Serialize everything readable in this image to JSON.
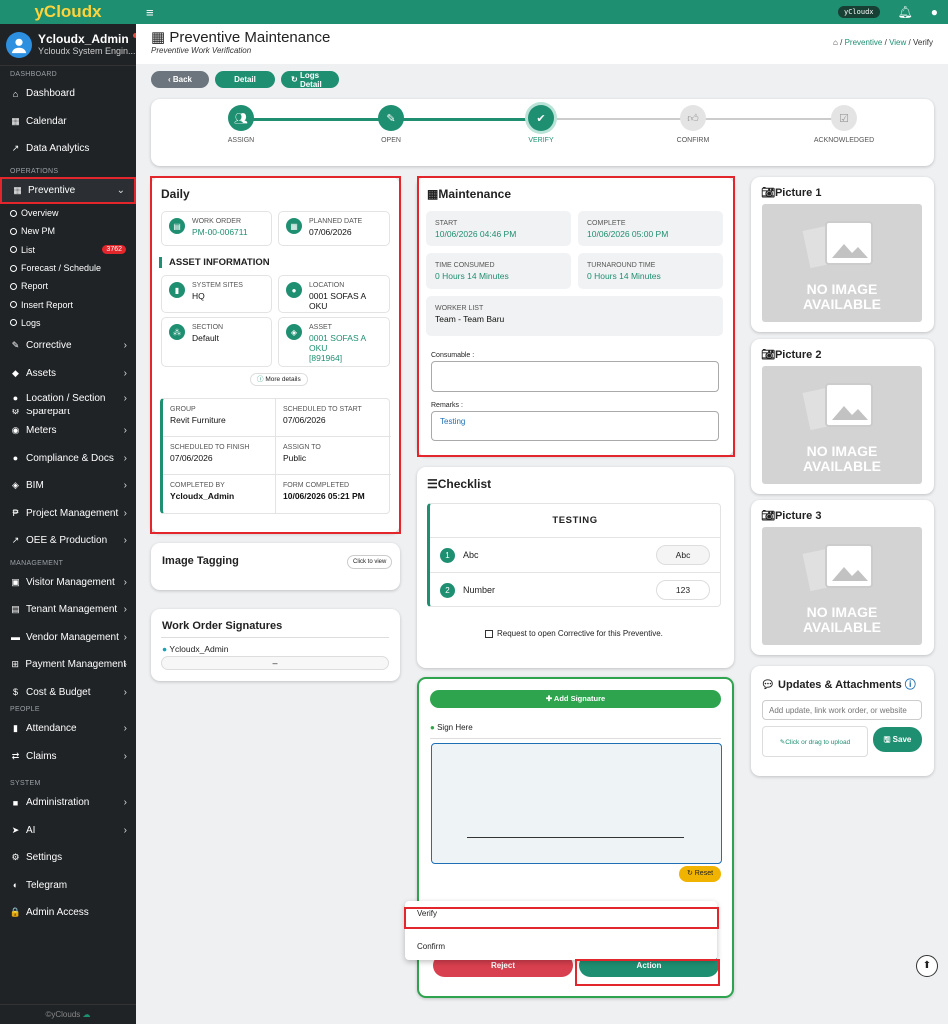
{
  "brand": "yCloudx",
  "user": {
    "name": "Ycloudx_Admin",
    "role": "Ycloudx System Engin..."
  },
  "sidebar": {
    "sec_dashboard": "DASHBOARD",
    "dashboard": "Dashboard",
    "calendar": "Calendar",
    "analytics": "Data Analytics",
    "sec_operations": "OPERATIONS",
    "preventive": "Preventive",
    "subs": [
      "Overview",
      "New PM",
      "List",
      "Forecast / Schedule",
      "Report",
      "Insert Report",
      "Logs"
    ],
    "list_badge": "3762",
    "corrective": "Corrective",
    "assets": "Assets",
    "location": "Location / Section",
    "sparepart": "Sparepart",
    "meters": "Meters",
    "compliance": "Compliance & Docs",
    "bim": "BIM",
    "project": "Project Management",
    "oee": "OEE & Production",
    "sec_management": "MANAGEMENT",
    "visitor": "Visitor Management",
    "tenant": "Tenant Management",
    "vendor": "Vendor Management",
    "payment": "Payment Management",
    "cost": "Cost & Budget",
    "sec_people": "PEOPLE",
    "attendance": "Attendance",
    "claims": "Claims",
    "sec_system": "SYSTEM",
    "administration": "Administration",
    "ai": "AI",
    "settings": "Settings",
    "telegram": "Telegram",
    "admin_access": "Admin Access",
    "copyright": "©yClouds"
  },
  "topbar": {
    "pill": "yCloudx"
  },
  "header": {
    "title": "Preventive Maintenance",
    "subtitle": "Preventive Work Verification",
    "bc1": "Preventive",
    "bc_sep": "/",
    "bc2": "View",
    "bc3": "Verify"
  },
  "buttons": {
    "back": "Back",
    "detail": "Detail",
    "logs": "Logs Detail"
  },
  "steps": [
    "ASSIGN",
    "OPEN",
    "VERIFY",
    "CONFIRM",
    "ACKNOWLEDGED"
  ],
  "daily": {
    "title": "Daily",
    "work_order_k": "WORK ORDER",
    "work_order_v": "PM-00-006711",
    "planned_k": "PLANNED DATE",
    "planned_v": "07/06/2026",
    "asset_info": "ASSET INFORMATION",
    "sites_k": "SYSTEM SITES",
    "sites_v": "HQ",
    "location_k": "LOCATION",
    "location_v": "0001 SOFAS A OKU",
    "section_k": "SECTION",
    "section_v": "Default",
    "asset_k": "ASSET",
    "asset_v1": "0001 SOFAS A OKU",
    "asset_v2": "[891964]",
    "more": "More details",
    "group_k": "GROUP",
    "group_v": "Revit Furniture",
    "sched_start_k": "SCHEDULED TO START",
    "sched_start_v": "07/06/2026",
    "sched_finish_k": "SCHEDULED TO FINISH",
    "sched_finish_v": "07/06/2026",
    "assign_k": "ASSIGN TO",
    "assign_v": "Public",
    "completed_k": "COMPLETED BY",
    "completed_v": "Ycloudx_Admin",
    "form_k": "FORM COMPLETED",
    "form_v": "10/06/2026 05:21 PM"
  },
  "tagging": {
    "title": "Image Tagging",
    "btn": "Click to view"
  },
  "signatures": {
    "title": "Work Order Signatures",
    "name": "Ycloudx_Admin",
    "value": "–"
  },
  "maintenance": {
    "title": "Maintenance",
    "start_k": "START",
    "start_v": "10/06/2026 04:46 PM",
    "complete_k": "COMPLETE",
    "complete_v": "10/06/2026 05:00 PM",
    "time_k": "TIME CONSUMED",
    "time_v": "0 Hours 14 Minutes",
    "turn_k": "TURNAROUND TIME",
    "turn_v": "0 Hours 14 Minutes",
    "worker_k": "WORKER LIST",
    "worker_v": "Team - Team Baru",
    "consumable_label": "Consumable :",
    "consumable_value": "",
    "remarks_label": "Remarks :",
    "remarks_value": "Testing"
  },
  "checklist": {
    "title": "Checklist",
    "header": "TESTING",
    "items": [
      {
        "num": "1",
        "label": "Abc",
        "value": "Abc"
      },
      {
        "num": "2",
        "label": "Number",
        "value": "123"
      }
    ],
    "corrective_request": "Request to open Corrective for this Preventive."
  },
  "signpanel": {
    "add": "Add Signature",
    "sign_here": "Sign Here",
    "reset": "Reset",
    "menu": [
      "Verify",
      "Confirm"
    ],
    "reject": "Reject",
    "action": "Action"
  },
  "pictures": {
    "p1": "Picture 1",
    "p2": "Picture 2",
    "p3": "Picture 3",
    "noimg1": "NO IMAGE",
    "noimg2": "AVAILABLE"
  },
  "updates": {
    "title": "Updates & Attachments",
    "placeholder": "Add update, link work order, or website",
    "upload": "Click or drag to upload",
    "save": "Save"
  }
}
